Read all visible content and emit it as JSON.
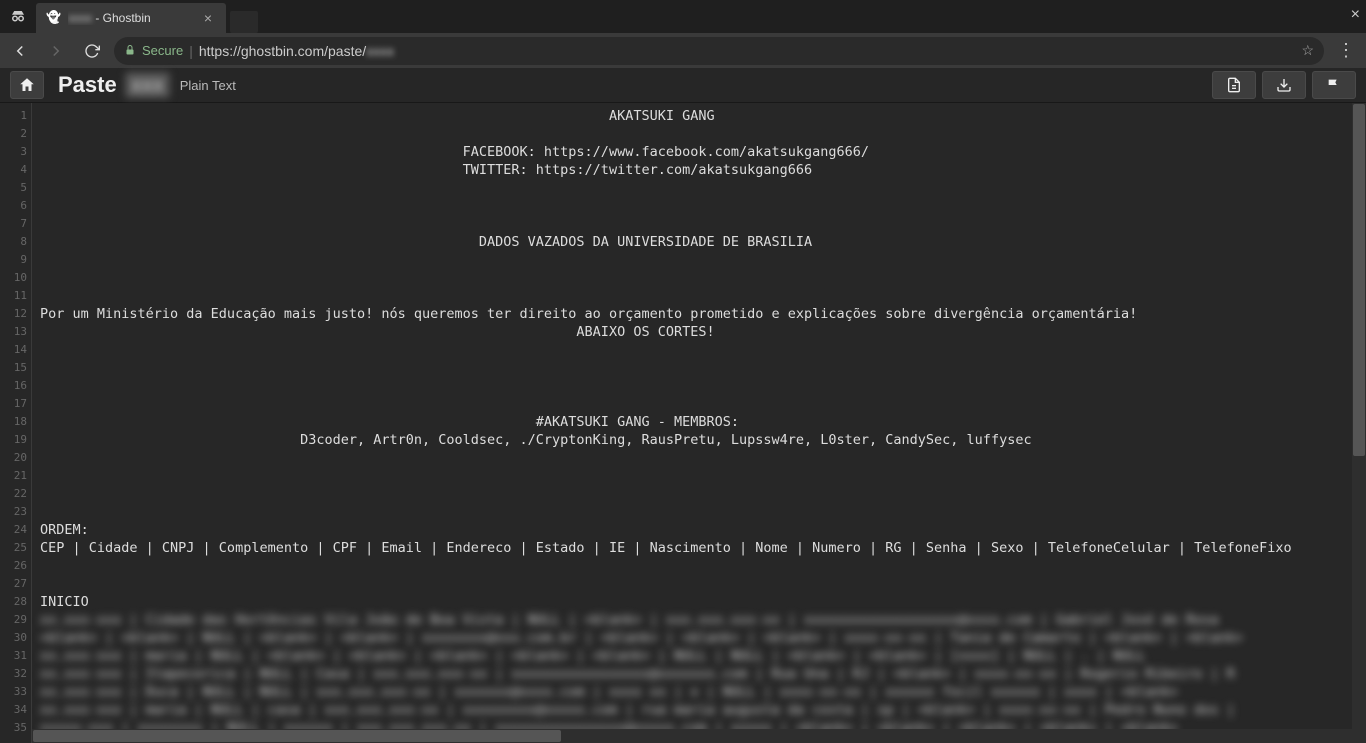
{
  "browser": {
    "tab_title_suffix": " - Ghostbin",
    "secure_label": "Secure",
    "url_prefix": "https://ghostbin.com/paste/"
  },
  "header": {
    "paste_label": "Paste",
    "lang_label": "Plain Text"
  },
  "code": {
    "lines": [
      "                                                                      AKATSUKI GANG",
      "",
      "                                                    FACEBOOK: https://www.facebook.com/akatsukgang666/",
      "                                                    TWITTER: https://twitter.com/akatsukgang666",
      "",
      "",
      "",
      "                                                      DADOS VAZADOS DA UNIVERSIDADE DE BRASILIA",
      "",
      "",
      "",
      "Por um Ministério da Educação mais justo! nós queremos ter direito ao orçamento prometido e explicações sobre divergência orçamentária!",
      "                                                                  ABAIXO OS CORTES!",
      "",
      "",
      "",
      "",
      "                                                             #AKATSUKI GANG - MEMBROS:",
      "                                D3coder, Artr0n, Cooldsec, ./CryptonKing, RausPretu, Lupssw4re, L0ster, CandySec, luffysec",
      "",
      "",
      "",
      "",
      "ORDEM:",
      "CEP | Cidade | CNPJ | Complemento | CPF | Email | Endereco | Estado | IE | Nascimento | Nome | Numero | RG | Senha | Sexo | TelefoneCelular | TelefoneFixo",
      "",
      "",
      "INICIO"
    ],
    "blurred_lines": [
      "xx.xxx-xxx | Cidade das Hortências Vila João de Boa Vista | NULL | <blank> | xxx.xxx.xxx-xx | xxxxxxxxxxxxxxxxxxx@xxxx.com | Gabriel José de Rosa",
      "<blank> | <blank> | NULL | <blank> | <blank> | xxxxxxxx@xxx.com.br | <blank> | <blank> | <blank> | xxxx-xx-xx | Tania de Camarto | <blank> | <blank>",
      "xx.xxx-xxx | maria | NULL | <blank> | <blank> | <blank> | <blank> | <blank> | NULL | NULL | <blank> | <blank> | [xxxx] | NULL | . | NULL",
      "xx.xxx-xxx | Itapecerica | NULL | Casa | xxx.xxx.xxx-xx | xxxxxxxxxxxxxxxxx@xxxxxxx.com | Rua Una | RJ | <blank> | xxxx-xx-xx | Rogerio Ribeiro | R",
      "xx.xxx-xxx | Duca | NULL | NULL | xxx.xxx.xxx-xx | xxxxxxx@xxxx.com | xxxx xx | x | NULL | xxxx-xx-xx | xxxxxx focil xxxxxx | xxxx | <blank>",
      "xx.xxx-xxx | maria | NULL | casa | xxx.xxx.xxx-xx | xxxxxxxxx@xxxxx.com | rua maria augusta da costa | sp | <blank> | xxxx-xx-xx | Pedro Nuno dos |",
      "xxxxx-xxx | xxxxxxxx | NULL | xxxxxx | xxx.xxx.xxx-xx | xxxxxxxxxxxxxxxx@xxxxx.com | xxxxx | <blank> | <blank> | <blank> | <blank> | <blank>"
    ]
  }
}
